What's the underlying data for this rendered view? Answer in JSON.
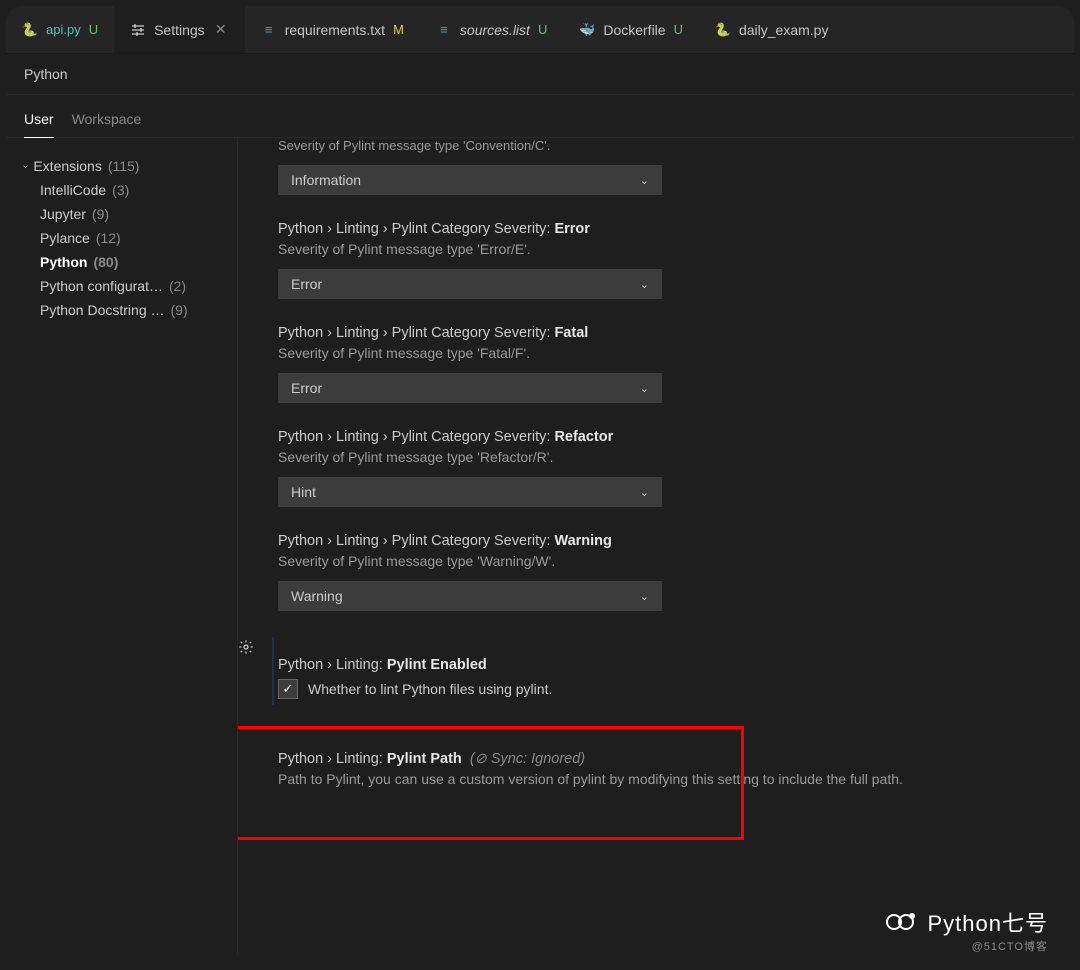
{
  "tabs": [
    {
      "label": "api.py",
      "modifier": "U",
      "icon": "python"
    },
    {
      "label": "Settings",
      "active": true,
      "icon": "gear"
    },
    {
      "label": "requirements.txt",
      "modifier": "M",
      "icon": "file"
    },
    {
      "label": "sources.list",
      "modifier": "U",
      "icon": "file",
      "italic": true
    },
    {
      "label": "Dockerfile",
      "modifier": "U",
      "icon": "docker"
    },
    {
      "label": "daily_exam.py",
      "icon": "python-blue"
    }
  ],
  "search_text": "Python",
  "scopes": {
    "user": "User",
    "workspace": "Workspace"
  },
  "sidebar": {
    "root": {
      "label": "Extensions",
      "count": "(115)"
    },
    "items": [
      {
        "label": "IntelliCode",
        "count": "(3)"
      },
      {
        "label": "Jupyter",
        "count": "(9)"
      },
      {
        "label": "Pylance",
        "count": "(12)"
      },
      {
        "label": "Python",
        "count": "(80)",
        "selected": true
      },
      {
        "label": "Python configurat…",
        "count": "(2)"
      },
      {
        "label": "Python Docstring …",
        "count": "(9)"
      }
    ]
  },
  "settings": {
    "s0": {
      "desc": "Severity of Pylint message type 'Convention/C'.",
      "value": "Information"
    },
    "s1": {
      "prefix": "Python › Linting › Pylint Category Severity: ",
      "bold": "Error",
      "desc": "Severity of Pylint message type 'Error/E'.",
      "value": "Error"
    },
    "s2": {
      "prefix": "Python › Linting › Pylint Category Severity: ",
      "bold": "Fatal",
      "desc": "Severity of Pylint message type 'Fatal/F'.",
      "value": "Error"
    },
    "s3": {
      "prefix": "Python › Linting › Pylint Category Severity: ",
      "bold": "Refactor",
      "desc": "Severity of Pylint message type 'Refactor/R'.",
      "value": "Hint"
    },
    "s4": {
      "prefix": "Python › Linting › Pylint Category Severity: ",
      "bold": "Warning",
      "desc": "Severity of Pylint message type 'Warning/W'.",
      "value": "Warning"
    },
    "s5": {
      "prefix": "Python › Linting: ",
      "bold": "Pylint Enabled",
      "check": "Whether to lint Python files using pylint."
    },
    "s6": {
      "prefix": "Python › Linting: ",
      "bold": "Pylint Path",
      "sync": "(   Sync: Ignored)",
      "desc": "Path to Pylint, you can use a custom version of pylint by modifying this setting to include the full path."
    }
  },
  "watermark": {
    "text": "Python七号",
    "sub": "@51CTO博客"
  }
}
